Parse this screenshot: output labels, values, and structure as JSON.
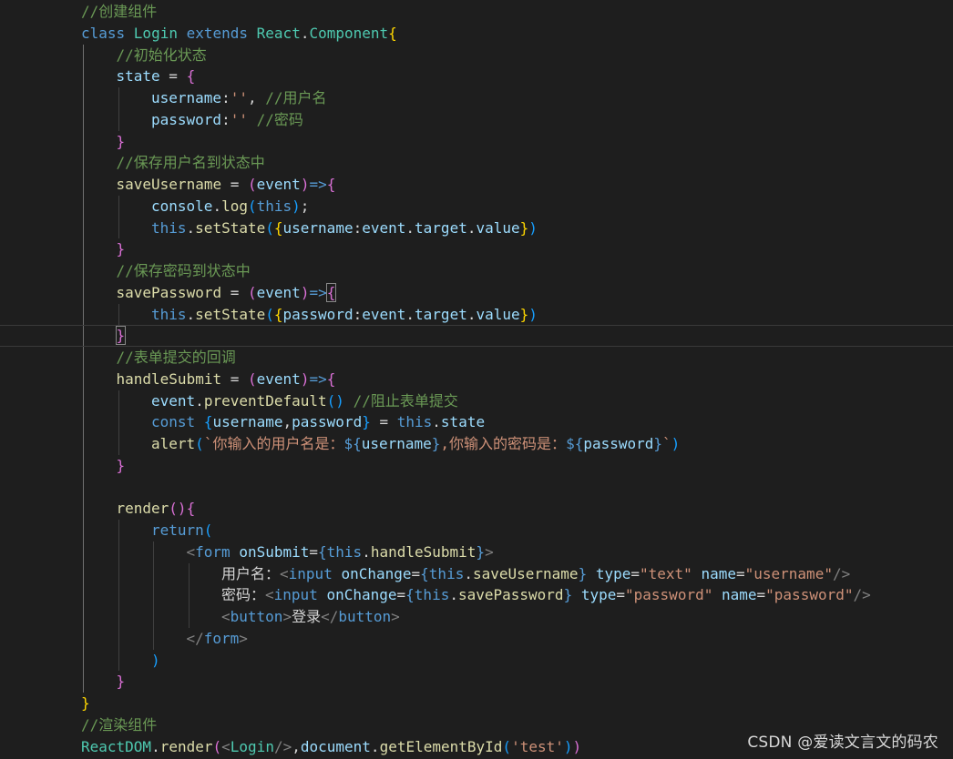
{
  "editor": {
    "theme_colors": {
      "background": "#1e1e1e",
      "comment": "#6a9955",
      "keyword": "#569cd6",
      "class": "#4ec9b0",
      "variable": "#9cdcfe",
      "function": "#dcdcaa",
      "string": "#ce9178",
      "text": "#d4d4d4",
      "bracket_level_1": "#ffd700",
      "bracket_level_2": "#da70d6",
      "bracket_level_3": "#179fff"
    },
    "lines": [
      {
        "indent": 0,
        "tokens": [
          [
            "cm",
            "//创建组件"
          ]
        ]
      },
      {
        "indent": 0,
        "tokens": [
          [
            "kw",
            "class "
          ],
          [
            "cl",
            "Login "
          ],
          [
            "kw",
            "extends "
          ],
          [
            "cl",
            "React"
          ],
          [
            "op",
            "."
          ],
          [
            "cl",
            "Component"
          ],
          [
            "b1",
            "{"
          ]
        ]
      },
      {
        "indent": 1,
        "tokens": [
          [
            "cm",
            "//初始化状态"
          ]
        ]
      },
      {
        "indent": 1,
        "tokens": [
          [
            "va",
            "state "
          ],
          [
            "op",
            "= "
          ],
          [
            "b2",
            "{"
          ]
        ]
      },
      {
        "indent": 2,
        "tokens": [
          [
            "va",
            "username"
          ],
          [
            "op",
            ":"
          ],
          [
            "st",
            "''"
          ],
          [
            "op",
            ", "
          ],
          [
            "cm",
            "//用户名"
          ]
        ]
      },
      {
        "indent": 2,
        "tokens": [
          [
            "va",
            "password"
          ],
          [
            "op",
            ":"
          ],
          [
            "st",
            "'' "
          ],
          [
            "cm",
            "//密码"
          ]
        ]
      },
      {
        "indent": 1,
        "tokens": [
          [
            "b2",
            "}"
          ]
        ]
      },
      {
        "indent": 1,
        "tokens": [
          [
            "cm",
            "//保存用户名到状态中"
          ]
        ]
      },
      {
        "indent": 1,
        "tokens": [
          [
            "fn",
            "saveUsername "
          ],
          [
            "op",
            "= "
          ],
          [
            "b2",
            "("
          ],
          [
            "va",
            "event"
          ],
          [
            "b2",
            ")"
          ],
          [
            "kw",
            "=>"
          ],
          [
            "b2",
            "{"
          ]
        ]
      },
      {
        "indent": 2,
        "tokens": [
          [
            "va",
            "console"
          ],
          [
            "op",
            "."
          ],
          [
            "fn",
            "log"
          ],
          [
            "b3",
            "("
          ],
          [
            "kw",
            "this"
          ],
          [
            "b3",
            ")"
          ],
          [
            "op",
            ";"
          ]
        ]
      },
      {
        "indent": 2,
        "tokens": [
          [
            "kw",
            "this"
          ],
          [
            "op",
            "."
          ],
          [
            "fn",
            "setState"
          ],
          [
            "b3",
            "("
          ],
          [
            "b1",
            "{"
          ],
          [
            "va",
            "username"
          ],
          [
            "op",
            ":"
          ],
          [
            "va",
            "event"
          ],
          [
            "op",
            "."
          ],
          [
            "va",
            "target"
          ],
          [
            "op",
            "."
          ],
          [
            "va",
            "value"
          ],
          [
            "b1",
            "}"
          ],
          [
            "b3",
            ")"
          ]
        ]
      },
      {
        "indent": 1,
        "tokens": [
          [
            "b2",
            "}"
          ]
        ]
      },
      {
        "indent": 1,
        "tokens": [
          [
            "cm",
            "//保存密码到状态中"
          ]
        ]
      },
      {
        "indent": 1,
        "tokens": [
          [
            "fn",
            "savePassword "
          ],
          [
            "op",
            "= "
          ],
          [
            "b2",
            "("
          ],
          [
            "va",
            "event"
          ],
          [
            "b2",
            ")"
          ],
          [
            "kw",
            "=>"
          ],
          [
            "b2",
            "{",
            "match"
          ]
        ]
      },
      {
        "indent": 2,
        "tokens": [
          [
            "kw",
            "this"
          ],
          [
            "op",
            "."
          ],
          [
            "fn",
            "setState"
          ],
          [
            "b3",
            "("
          ],
          [
            "b1",
            "{"
          ],
          [
            "va",
            "password"
          ],
          [
            "op",
            ":"
          ],
          [
            "va",
            "event"
          ],
          [
            "op",
            "."
          ],
          [
            "va",
            "target"
          ],
          [
            "op",
            "."
          ],
          [
            "va",
            "value"
          ],
          [
            "b1",
            "}"
          ],
          [
            "b3",
            ")"
          ]
        ]
      },
      {
        "indent": 1,
        "current": true,
        "tokens": [
          [
            "b2",
            "}",
            "match"
          ]
        ]
      },
      {
        "indent": 1,
        "tokens": [
          [
            "cm",
            "//表单提交的回调"
          ]
        ]
      },
      {
        "indent": 1,
        "tokens": [
          [
            "fn",
            "handleSubmit "
          ],
          [
            "op",
            "= "
          ],
          [
            "b2",
            "("
          ],
          [
            "va",
            "event"
          ],
          [
            "b2",
            ")"
          ],
          [
            "kw",
            "=>"
          ],
          [
            "b2",
            "{"
          ]
        ]
      },
      {
        "indent": 2,
        "tokens": [
          [
            "va",
            "event"
          ],
          [
            "op",
            "."
          ],
          [
            "fn",
            "preventDefault"
          ],
          [
            "b3",
            "()"
          ],
          [
            "op",
            " "
          ],
          [
            "cm",
            "//阻止表单提交"
          ]
        ]
      },
      {
        "indent": 2,
        "tokens": [
          [
            "kw",
            "const "
          ],
          [
            "b3",
            "{"
          ],
          [
            "va",
            "username"
          ],
          [
            "op",
            ","
          ],
          [
            "va",
            "password"
          ],
          [
            "b3",
            "}"
          ],
          [
            "op",
            " = "
          ],
          [
            "kw",
            "this"
          ],
          [
            "op",
            "."
          ],
          [
            "va",
            "state"
          ]
        ]
      },
      {
        "indent": 2,
        "tokens": [
          [
            "fn",
            "alert"
          ],
          [
            "b3",
            "("
          ],
          [
            "st",
            "`你输入的用户名是："
          ],
          [
            "kw",
            "${"
          ],
          [
            "va",
            "username"
          ],
          [
            "kw",
            "}"
          ],
          [
            "st",
            ",你输入的密码是："
          ],
          [
            "kw",
            "${"
          ],
          [
            "va",
            "password"
          ],
          [
            "kw",
            "}"
          ],
          [
            "st",
            "`"
          ],
          [
            "b3",
            ")"
          ]
        ]
      },
      {
        "indent": 1,
        "tokens": [
          [
            "b2",
            "}"
          ]
        ]
      },
      {
        "indent": 0,
        "tokens": []
      },
      {
        "indent": 1,
        "tokens": [
          [
            "fn",
            "render"
          ],
          [
            "b2",
            "()"
          ],
          [
            "b2",
            "{"
          ]
        ]
      },
      {
        "indent": 2,
        "tokens": [
          [
            "kw",
            "return"
          ],
          [
            "b3",
            "("
          ]
        ]
      },
      {
        "indent": 3,
        "tokens": [
          [
            "pu",
            "<"
          ],
          [
            "tg",
            "form "
          ],
          [
            "va",
            "onSubmit"
          ],
          [
            "op",
            "="
          ],
          [
            "kw",
            "{"
          ],
          [
            "kw",
            "this"
          ],
          [
            "op",
            "."
          ],
          [
            "fn",
            "handleSubmit"
          ],
          [
            "kw",
            "}"
          ],
          [
            "pu",
            ">"
          ]
        ]
      },
      {
        "indent": 4,
        "tokens": [
          [
            "tx",
            "用户名："
          ],
          [
            "pu",
            "<"
          ],
          [
            "tg",
            "input "
          ],
          [
            "va",
            "onChange"
          ],
          [
            "op",
            "="
          ],
          [
            "kw",
            "{"
          ],
          [
            "kw",
            "this"
          ],
          [
            "op",
            "."
          ],
          [
            "fn",
            "saveUsername"
          ],
          [
            "kw",
            "}"
          ],
          [
            "va",
            " type"
          ],
          [
            "op",
            "="
          ],
          [
            "st",
            "\"text\""
          ],
          [
            "va",
            " name"
          ],
          [
            "op",
            "="
          ],
          [
            "st",
            "\"username\""
          ],
          [
            "pu",
            "/>"
          ]
        ]
      },
      {
        "indent": 4,
        "tokens": [
          [
            "tx",
            "密码："
          ],
          [
            "pu",
            "<"
          ],
          [
            "tg",
            "input "
          ],
          [
            "va",
            "onChange"
          ],
          [
            "op",
            "="
          ],
          [
            "kw",
            "{"
          ],
          [
            "kw",
            "this"
          ],
          [
            "op",
            "."
          ],
          [
            "fn",
            "savePassword"
          ],
          [
            "kw",
            "}"
          ],
          [
            "va",
            " type"
          ],
          [
            "op",
            "="
          ],
          [
            "st",
            "\"password\""
          ],
          [
            "va",
            " name"
          ],
          [
            "op",
            "="
          ],
          [
            "st",
            "\"password\""
          ],
          [
            "pu",
            "/>"
          ]
        ]
      },
      {
        "indent": 4,
        "tokens": [
          [
            "pu",
            "<"
          ],
          [
            "tg",
            "button"
          ],
          [
            "pu",
            ">"
          ],
          [
            "tx",
            "登录"
          ],
          [
            "pu",
            "</"
          ],
          [
            "tg",
            "button"
          ],
          [
            "pu",
            ">"
          ]
        ]
      },
      {
        "indent": 3,
        "tokens": [
          [
            "pu",
            "</"
          ],
          [
            "tg",
            "form"
          ],
          [
            "pu",
            ">"
          ]
        ]
      },
      {
        "indent": 2,
        "tokens": [
          [
            "b3",
            ")"
          ]
        ]
      },
      {
        "indent": 1,
        "tokens": [
          [
            "b2",
            "}"
          ]
        ]
      },
      {
        "indent": 0,
        "tokens": [
          [
            "b1",
            "}"
          ]
        ]
      },
      {
        "indent": 0,
        "tokens": [
          [
            "cm",
            "//渲染组件"
          ]
        ]
      },
      {
        "indent": 0,
        "tokens": [
          [
            "cl",
            "ReactDOM"
          ],
          [
            "op",
            "."
          ],
          [
            "fn",
            "render"
          ],
          [
            "b2",
            "("
          ],
          [
            "pu",
            "<"
          ],
          [
            "cl",
            "Login"
          ],
          [
            "pu",
            "/>"
          ],
          [
            "op",
            ","
          ],
          [
            "va",
            "document"
          ],
          [
            "op",
            "."
          ],
          [
            "fn",
            "getElementById"
          ],
          [
            "b3",
            "("
          ],
          [
            "st",
            "'test'"
          ],
          [
            "b3",
            ")"
          ],
          [
            "b2",
            ")"
          ]
        ]
      }
    ]
  },
  "watermark": {
    "text": "CSDN @爱读文言文的码农"
  }
}
